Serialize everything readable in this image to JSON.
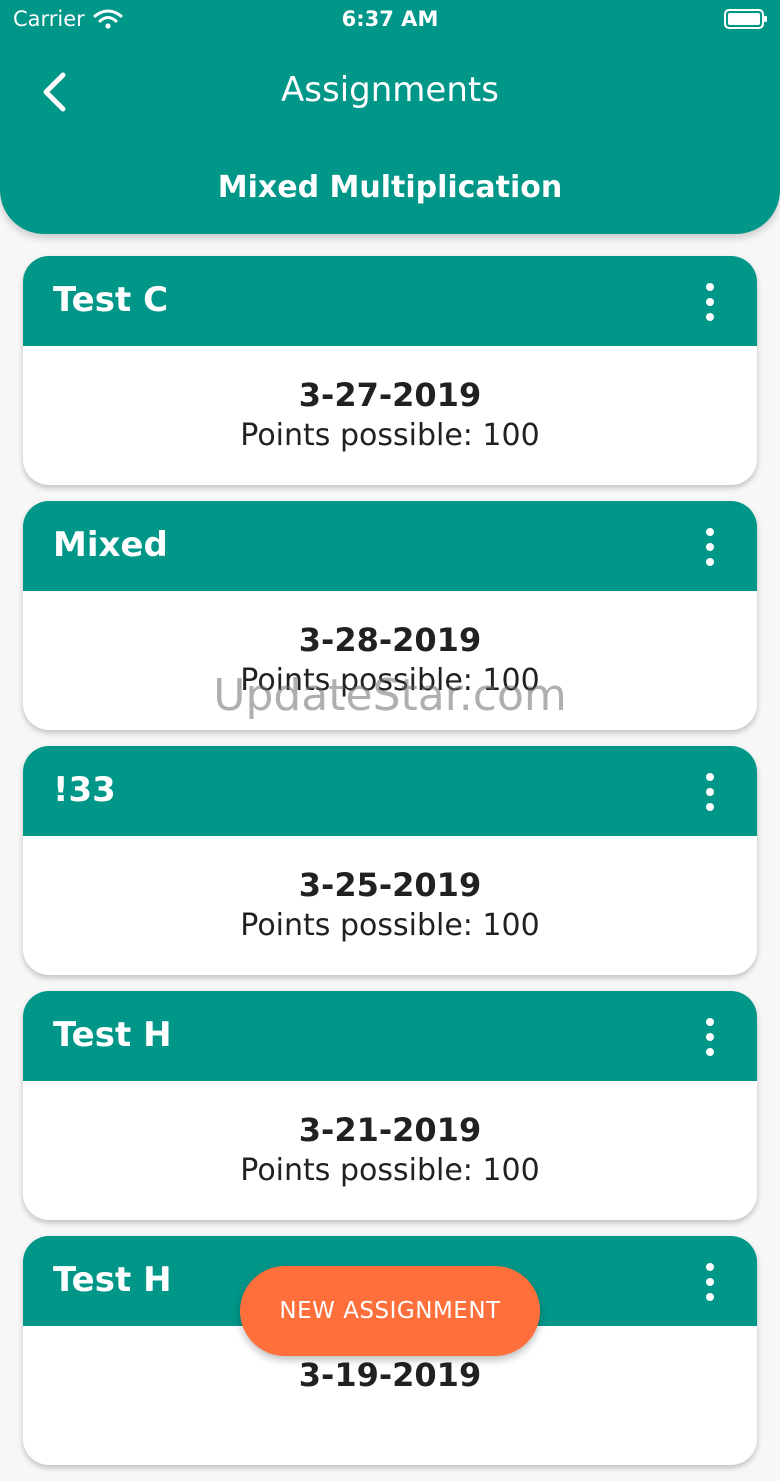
{
  "status_bar": {
    "carrier": "Carrier",
    "time": "6:37 AM"
  },
  "header": {
    "title": "Assignments",
    "subtitle": "Mixed Multiplication"
  },
  "assignments": [
    {
      "name": "Test C",
      "date": "3-27-2019",
      "points": "Points possible: 100"
    },
    {
      "name": "Mixed",
      "date": "3-28-2019",
      "points": "Points possible: 100"
    },
    {
      "name": "!33",
      "date": "3-25-2019",
      "points": "Points possible: 100"
    },
    {
      "name": "Test H",
      "date": "3-21-2019",
      "points": "Points possible: 100"
    },
    {
      "name": "Test H",
      "date": "3-19-2019",
      "points": ""
    }
  ],
  "fab": {
    "label": "NEW ASSIGNMENT"
  },
  "watermark": "UpdateStar.com",
  "colors": {
    "primary": "#009688",
    "accent": "#ff6f3c",
    "background": "#f7f7f7",
    "text_dark": "#212121"
  },
  "icons": {
    "back": "chevron-left-icon",
    "more": "more-vertical-icon",
    "wifi": "wifi-icon",
    "battery": "battery-icon"
  }
}
